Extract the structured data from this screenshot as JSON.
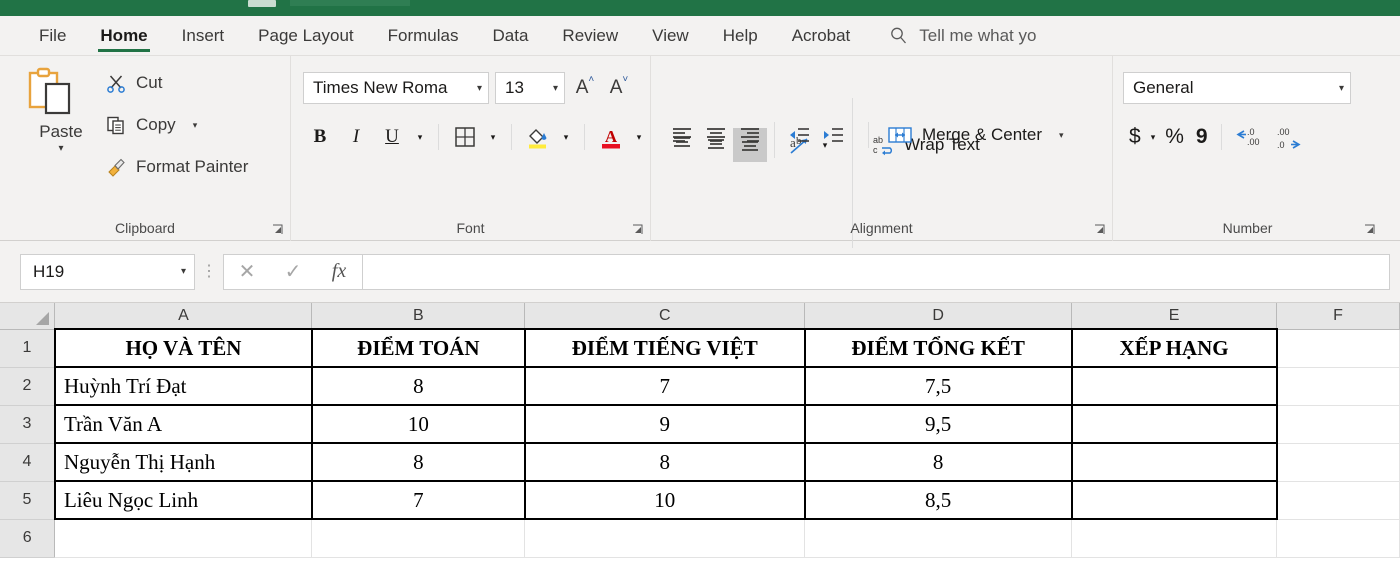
{
  "titlebar": {
    "color": "#217346"
  },
  "tabs": [
    {
      "label": "File",
      "active": false
    },
    {
      "label": "Home",
      "active": true
    },
    {
      "label": "Insert",
      "active": false
    },
    {
      "label": "Page Layout",
      "active": false
    },
    {
      "label": "Formulas",
      "active": false
    },
    {
      "label": "Data",
      "active": false
    },
    {
      "label": "Review",
      "active": false
    },
    {
      "label": "View",
      "active": false
    },
    {
      "label": "Help",
      "active": false
    },
    {
      "label": "Acrobat",
      "active": false
    }
  ],
  "tellme": {
    "text": "Tell me what yo",
    "icon": "search-icon"
  },
  "ribbon": {
    "clipboard": {
      "group_label": "Clipboard",
      "paste_label": "Paste",
      "cut_label": "Cut",
      "copy_label": "Copy",
      "format_painter_label": "Format Painter"
    },
    "font": {
      "group_label": "Font",
      "font_name": "Times New Roma",
      "font_size": "13",
      "grow_font": "A",
      "shrink_font": "A",
      "bold": "B",
      "italic": "I",
      "underline": "U"
    },
    "alignment": {
      "group_label": "Alignment",
      "wrap_text_label": "Wrap Text",
      "merge_center_label": "Merge & Center",
      "selected_vertical_align": "bottom-align"
    },
    "number": {
      "group_label": "Number",
      "format": "General",
      "currency": "$",
      "percent": "%",
      "comma": "9"
    }
  },
  "formula_bar": {
    "name_box": "H19",
    "cancel_icon": "close-icon",
    "enter_icon": "check-icon",
    "function_icon": "fx-icon",
    "formula_value": "",
    "formula_placeholder": ""
  },
  "sheet": {
    "columns": [
      "A",
      "B",
      "C",
      "D",
      "E",
      "F"
    ],
    "rows": [
      "1",
      "2",
      "3",
      "4",
      "5",
      "6"
    ],
    "header_row": [
      "HỌ VÀ TÊN",
      "ĐIỂM TOÁN",
      "ĐIỂM TIẾNG VIỆT",
      "ĐIỂM TỔNG KẾT",
      "XẾP HẠNG",
      ""
    ],
    "data_rows": [
      {
        "row": "2",
        "cells": [
          "Huỳnh Trí Đạt",
          "8",
          "7",
          "7,5",
          "",
          ""
        ]
      },
      {
        "row": "3",
        "cells": [
          "Trần Văn A",
          "10",
          "9",
          "9,5",
          "",
          ""
        ]
      },
      {
        "row": "4",
        "cells": [
          "Nguyễn Thị Hạnh",
          "8",
          "8",
          "8",
          "",
          ""
        ]
      },
      {
        "row": "5",
        "cells": [
          "Liêu Ngọc Linh",
          "7",
          "10",
          "8,5",
          "",
          ""
        ]
      },
      {
        "row": "6",
        "cells": [
          "",
          "",
          "",
          "",
          "",
          ""
        ]
      }
    ]
  }
}
